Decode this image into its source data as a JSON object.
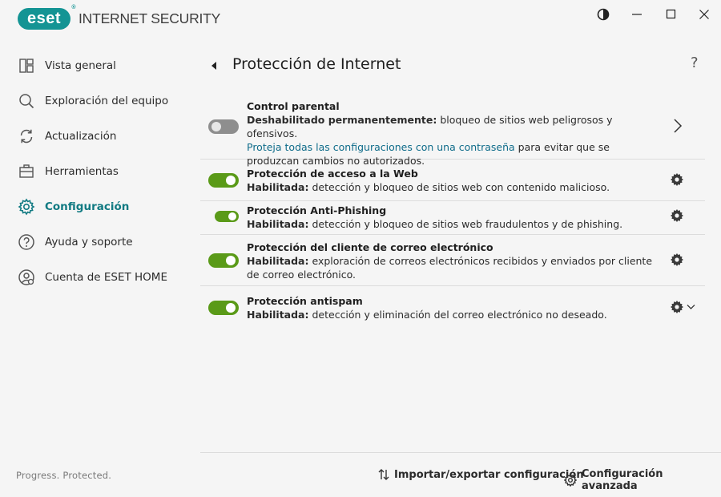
{
  "app": {
    "logo_text": "eset",
    "logo_mark": "®",
    "product": "INTERNET SECURITY",
    "brand_color": "#149494"
  },
  "window_controls": {
    "theme_icon": "contrast-icon",
    "minimize_icon": "minimize-icon",
    "maximize_icon": "maximize-icon",
    "close_icon": "close-icon"
  },
  "sidebar": {
    "items": [
      {
        "label": "Vista general",
        "icon": "dashboard-icon",
        "active": false
      },
      {
        "label": "Exploración del equipo",
        "icon": "search-icon",
        "active": false
      },
      {
        "label": "Actualización",
        "icon": "refresh-icon",
        "active": false
      },
      {
        "label": "Herramientas",
        "icon": "toolbox-icon",
        "active": false
      },
      {
        "label": "Configuración",
        "icon": "gear-icon",
        "active": true
      },
      {
        "label": "Ayuda y soporte",
        "icon": "help-icon",
        "active": false
      },
      {
        "label": "Cuenta de ESET HOME",
        "icon": "account-icon",
        "active": false
      }
    ],
    "footer": "Progress. Protected."
  },
  "main": {
    "title": "Protección de Internet",
    "help": "?",
    "rows": [
      {
        "title": "Control parental",
        "status": "Deshabilitado permanentemente:",
        "desc": " bloqueo de sitios web peligrosos y ofensivos.",
        "link": "Proteja todas las configuraciones con una contraseña",
        "desc2": " para evitar que se produzcan cambios no autorizados.",
        "enabled": false
      },
      {
        "title": "Protección de acceso a la Web",
        "status": "Habilitada:",
        "desc": " detección y bloqueo de sitios web con contenido malicioso.",
        "enabled": true
      },
      {
        "title": "Protección Anti-Phishing",
        "status": "Habilitada:",
        "desc": " detección y bloqueo de sitios web fraudulentos y de phishing.",
        "enabled": true
      },
      {
        "title": "Protección del cliente de correo electrónico",
        "status": "Habilitada:",
        "desc": " exploración de correos electrónicos recibidos y enviados por cliente de correo electrónico.",
        "enabled": true
      },
      {
        "title": "Protección antispam",
        "status": "Habilitada:",
        "desc": " detección y eliminación del correo electrónico no deseado.",
        "enabled": true
      }
    ]
  },
  "footer": {
    "import_export": "Importar/exportar configuración",
    "advanced": "Configuración avanzada"
  },
  "colors": {
    "accent": "#117a82",
    "toggle_on": "#5a9a18",
    "toggle_off": "#8e8e8e",
    "link": "#0f6c8a"
  }
}
